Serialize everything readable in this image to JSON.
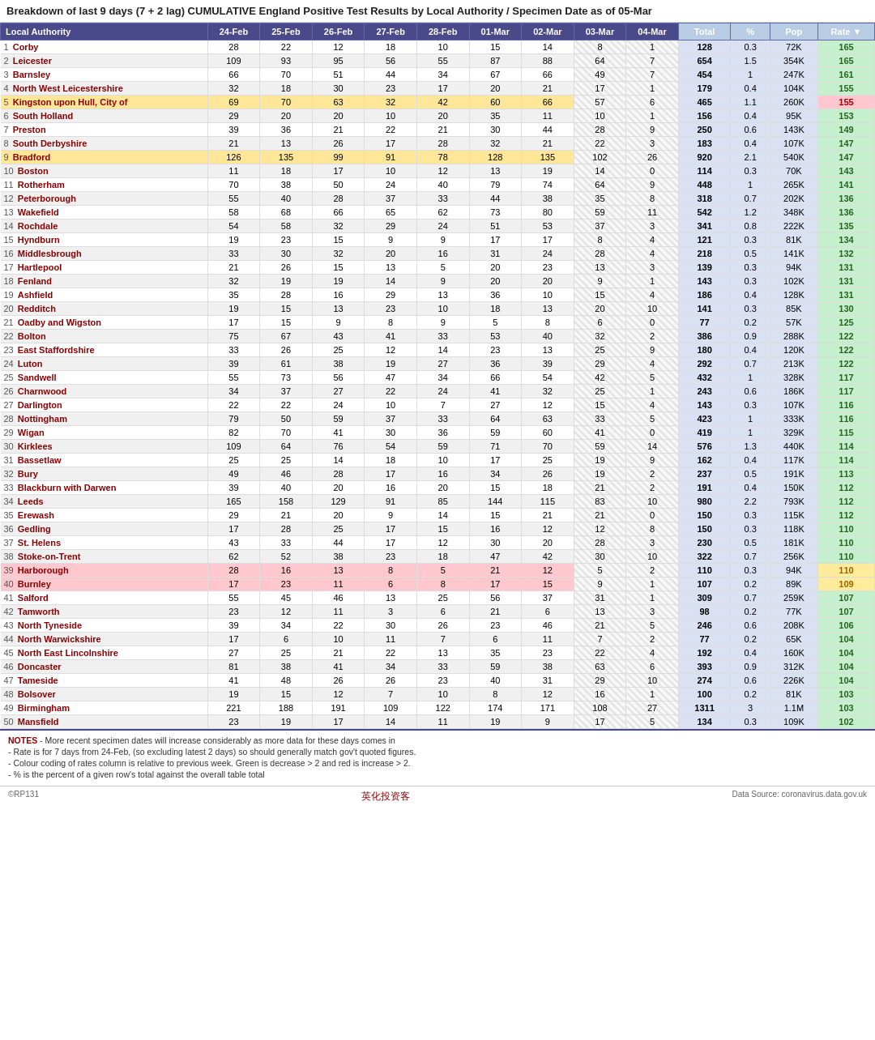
{
  "title": "Breakdown of last 9 days (7 + 2 lag)  CUMULATIVE England Positive Test Results by Local Authority / Specimen Date as of 05-Mar",
  "columns": [
    "Local Authority",
    "24-Feb",
    "25-Feb",
    "26-Feb",
    "27-Feb",
    "28-Feb",
    "01-Mar",
    "02-Mar",
    "03-Mar",
    "04-Mar",
    "Total",
    "%",
    "Pop",
    "Rate ▼"
  ],
  "rows": [
    {
      "rank": 1,
      "name": "Corby",
      "d1": 28,
      "d2": 22,
      "d3": 12,
      "d4": 18,
      "d5": 10,
      "d6": 15,
      "d7": 14,
      "d8": 8,
      "d9": 1,
      "total": 128,
      "pct": 0.3,
      "pop": "72K",
      "rate": 165,
      "rate_class": "rate-green"
    },
    {
      "rank": 2,
      "name": "Leicester",
      "d1": 109,
      "d2": 93,
      "d3": 95,
      "d4": 56,
      "d5": 55,
      "d6": 87,
      "d7": 88,
      "d8": 64,
      "d9": 7,
      "total": 654,
      "pct": 1.5,
      "pop": "354K",
      "rate": 165,
      "rate_class": "rate-green"
    },
    {
      "rank": 3,
      "name": "Barnsley",
      "d1": 66,
      "d2": 70,
      "d3": 51,
      "d4": 44,
      "d5": 34,
      "d6": 67,
      "d7": 66,
      "d8": 49,
      "d9": 7,
      "total": 454,
      "pct": 1.0,
      "pop": "247K",
      "rate": 161,
      "rate_class": "rate-green"
    },
    {
      "rank": 4,
      "name": "North West Leicestershire",
      "d1": 32,
      "d2": 18,
      "d3": 30,
      "d4": 23,
      "d5": 17,
      "d6": 20,
      "d7": 21,
      "d8": 17,
      "d9": 1,
      "total": 179,
      "pct": 0.4,
      "pop": "104K",
      "rate": 155,
      "rate_class": "rate-green"
    },
    {
      "rank": 5,
      "name": "Kingston upon Hull, City of",
      "d1": 69,
      "d2": 70,
      "d3": 63,
      "d4": 32,
      "d5": 42,
      "d6": 60,
      "d7": 66,
      "d8": 57,
      "d9": 6,
      "total": 465,
      "pct": 1.1,
      "pop": "260K",
      "rate": 155,
      "rate_class": "rate-red",
      "highlight": true
    },
    {
      "rank": 6,
      "name": "South Holland",
      "d1": 29,
      "d2": 20,
      "d3": 20,
      "d4": 10,
      "d5": 20,
      "d6": 35,
      "d7": 11,
      "d8": 10,
      "d9": 1,
      "total": 156,
      "pct": 0.4,
      "pop": "95K",
      "rate": 153,
      "rate_class": "rate-green"
    },
    {
      "rank": 7,
      "name": "Preston",
      "d1": 39,
      "d2": 36,
      "d3": 21,
      "d4": 22,
      "d5": 21,
      "d6": 30,
      "d7": 44,
      "d8": 28,
      "d9": 9,
      "total": 250,
      "pct": 0.6,
      "pop": "143K",
      "rate": 149,
      "rate_class": "rate-green"
    },
    {
      "rank": 8,
      "name": "South Derbyshire",
      "d1": 21,
      "d2": 13,
      "d3": 26,
      "d4": 17,
      "d5": 28,
      "d6": 32,
      "d7": 21,
      "d8": 22,
      "d9": 3,
      "total": 183,
      "pct": 0.4,
      "pop": "107K",
      "rate": 147,
      "rate_class": "rate-green"
    },
    {
      "rank": 9,
      "name": "Bradford",
      "d1": 126,
      "d2": 135,
      "d3": 99,
      "d4": 91,
      "d5": 78,
      "d6": 128,
      "d7": 135,
      "d8": 102,
      "d9": 26,
      "total": 920,
      "pct": 2.1,
      "pop": "540K",
      "rate": 147,
      "rate_class": "rate-green",
      "highlight": true
    },
    {
      "rank": 10,
      "name": "Boston",
      "d1": 11,
      "d2": 18,
      "d3": 17,
      "d4": 10,
      "d5": 12,
      "d6": 13,
      "d7": 19,
      "d8": 14,
      "d9": 0,
      "total": 114,
      "pct": 0.3,
      "pop": "70K",
      "rate": 143,
      "rate_class": "rate-green"
    },
    {
      "rank": 11,
      "name": "Rotherham",
      "d1": 70,
      "d2": 38,
      "d3": 50,
      "d4": 24,
      "d5": 40,
      "d6": 79,
      "d7": 74,
      "d8": 64,
      "d9": 9,
      "total": 448,
      "pct": 1.0,
      "pop": "265K",
      "rate": 141,
      "rate_class": "rate-green"
    },
    {
      "rank": 12,
      "name": "Peterborough",
      "d1": 55,
      "d2": 40,
      "d3": 28,
      "d4": 37,
      "d5": 33,
      "d6": 44,
      "d7": 38,
      "d8": 35,
      "d9": 8,
      "total": 318,
      "pct": 0.7,
      "pop": "202K",
      "rate": 136,
      "rate_class": "rate-green"
    },
    {
      "rank": 13,
      "name": "Wakefield",
      "d1": 58,
      "d2": 68,
      "d3": 66,
      "d4": 65,
      "d5": 62,
      "d6": 73,
      "d7": 80,
      "d8": 59,
      "d9": 11,
      "total": 542,
      "pct": 1.2,
      "pop": "348K",
      "rate": 136,
      "rate_class": "rate-green"
    },
    {
      "rank": 14,
      "name": "Rochdale",
      "d1": 54,
      "d2": 58,
      "d3": 32,
      "d4": 29,
      "d5": 24,
      "d6": 51,
      "d7": 53,
      "d8": 37,
      "d9": 3,
      "total": 341,
      "pct": 0.8,
      "pop": "222K",
      "rate": 135,
      "rate_class": "rate-green"
    },
    {
      "rank": 15,
      "name": "Hyndburn",
      "d1": 19,
      "d2": 23,
      "d3": 15,
      "d4": 9,
      "d5": 9,
      "d6": 17,
      "d7": 17,
      "d8": 8,
      "d9": 4,
      "total": 121,
      "pct": 0.3,
      "pop": "81K",
      "rate": 134,
      "rate_class": "rate-green"
    },
    {
      "rank": 16,
      "name": "Middlesbrough",
      "d1": 33,
      "d2": 30,
      "d3": 32,
      "d4": 20,
      "d5": 16,
      "d6": 31,
      "d7": 24,
      "d8": 28,
      "d9": 4,
      "total": 218,
      "pct": 0.5,
      "pop": "141K",
      "rate": 132,
      "rate_class": "rate-green"
    },
    {
      "rank": 17,
      "name": "Hartlepool",
      "d1": 21,
      "d2": 26,
      "d3": 15,
      "d4": 13,
      "d5": 5,
      "d6": 20,
      "d7": 23,
      "d8": 13,
      "d9": 3,
      "total": 139,
      "pct": 0.3,
      "pop": "94K",
      "rate": 131,
      "rate_class": "rate-green"
    },
    {
      "rank": 18,
      "name": "Fenland",
      "d1": 32,
      "d2": 19,
      "d3": 19,
      "d4": 14,
      "d5": 9,
      "d6": 20,
      "d7": 20,
      "d8": 9,
      "d9": 1,
      "total": 143,
      "pct": 0.3,
      "pop": "102K",
      "rate": 131,
      "rate_class": "rate-green"
    },
    {
      "rank": 19,
      "name": "Ashfield",
      "d1": 35,
      "d2": 28,
      "d3": 16,
      "d4": 29,
      "d5": 13,
      "d6": 36,
      "d7": 10,
      "d8": 15,
      "d9": 4,
      "total": 186,
      "pct": 0.4,
      "pop": "128K",
      "rate": 131,
      "rate_class": "rate-green"
    },
    {
      "rank": 20,
      "name": "Redditch",
      "d1": 19,
      "d2": 15,
      "d3": 13,
      "d4": 23,
      "d5": 10,
      "d6": 18,
      "d7": 13,
      "d8": 20,
      "d9": 10,
      "total": 141,
      "pct": 0.3,
      "pop": "85K",
      "rate": 130,
      "rate_class": "rate-green"
    },
    {
      "rank": 21,
      "name": "Oadby and Wigston",
      "d1": 17,
      "d2": 15,
      "d3": 9,
      "d4": 8,
      "d5": 9,
      "d6": 5,
      "d7": 8,
      "d8": 6,
      "d9": 0,
      "total": 77,
      "pct": 0.2,
      "pop": "57K",
      "rate": 125,
      "rate_class": "rate-green"
    },
    {
      "rank": 22,
      "name": "Bolton",
      "d1": 75,
      "d2": 67,
      "d3": 43,
      "d4": 41,
      "d5": 33,
      "d6": 53,
      "d7": 40,
      "d8": 32,
      "d9": 2,
      "total": 386,
      "pct": 0.9,
      "pop": "288K",
      "rate": 122,
      "rate_class": "rate-green"
    },
    {
      "rank": 23,
      "name": "East Staffordshire",
      "d1": 33,
      "d2": 26,
      "d3": 25,
      "d4": 12,
      "d5": 14,
      "d6": 23,
      "d7": 13,
      "d8": 25,
      "d9": 9,
      "total": 180,
      "pct": 0.4,
      "pop": "120K",
      "rate": 122,
      "rate_class": "rate-green"
    },
    {
      "rank": 24,
      "name": "Luton",
      "d1": 39,
      "d2": 61,
      "d3": 38,
      "d4": 19,
      "d5": 27,
      "d6": 36,
      "d7": 39,
      "d8": 29,
      "d9": 4,
      "total": 292,
      "pct": 0.7,
      "pop": "213K",
      "rate": 122,
      "rate_class": "rate-green"
    },
    {
      "rank": 25,
      "name": "Sandwell",
      "d1": 55,
      "d2": 73,
      "d3": 56,
      "d4": 47,
      "d5": 34,
      "d6": 66,
      "d7": 54,
      "d8": 42,
      "d9": 5,
      "total": 432,
      "pct": 1.0,
      "pop": "328K",
      "rate": 117,
      "rate_class": "rate-green"
    },
    {
      "rank": 26,
      "name": "Charnwood",
      "d1": 34,
      "d2": 37,
      "d3": 27,
      "d4": 22,
      "d5": 24,
      "d6": 41,
      "d7": 32,
      "d8": 25,
      "d9": 1,
      "total": 243,
      "pct": 0.6,
      "pop": "186K",
      "rate": 117,
      "rate_class": "rate-green"
    },
    {
      "rank": 27,
      "name": "Darlington",
      "d1": 22,
      "d2": 22,
      "d3": 24,
      "d4": 10,
      "d5": 7,
      "d6": 27,
      "d7": 12,
      "d8": 15,
      "d9": 4,
      "total": 143,
      "pct": 0.3,
      "pop": "107K",
      "rate": 116,
      "rate_class": "rate-green"
    },
    {
      "rank": 28,
      "name": "Nottingham",
      "d1": 79,
      "d2": 50,
      "d3": 59,
      "d4": 37,
      "d5": 33,
      "d6": 64,
      "d7": 63,
      "d8": 33,
      "d9": 5,
      "total": 423,
      "pct": 1.0,
      "pop": "333K",
      "rate": 116,
      "rate_class": "rate-green"
    },
    {
      "rank": 29,
      "name": "Wigan",
      "d1": 82,
      "d2": 70,
      "d3": 41,
      "d4": 30,
      "d5": 36,
      "d6": 59,
      "d7": 60,
      "d8": 41,
      "d9": 0,
      "total": 419,
      "pct": 1.0,
      "pop": "329K",
      "rate": 115,
      "rate_class": "rate-green"
    },
    {
      "rank": 30,
      "name": "Kirklees",
      "d1": 109,
      "d2": 64,
      "d3": 76,
      "d4": 54,
      "d5": 59,
      "d6": 71,
      "d7": 70,
      "d8": 59,
      "d9": 14,
      "total": 576,
      "pct": 1.3,
      "pop": "440K",
      "rate": 114,
      "rate_class": "rate-green"
    },
    {
      "rank": 31,
      "name": "Bassetlaw",
      "d1": 25,
      "d2": 25,
      "d3": 14,
      "d4": 18,
      "d5": 10,
      "d6": 17,
      "d7": 25,
      "d8": 19,
      "d9": 9,
      "total": 162,
      "pct": 0.4,
      "pop": "117K",
      "rate": 114,
      "rate_class": "rate-green"
    },
    {
      "rank": 32,
      "name": "Bury",
      "d1": 49,
      "d2": 46,
      "d3": 28,
      "d4": 17,
      "d5": 16,
      "d6": 34,
      "d7": 26,
      "d8": 19,
      "d9": 2,
      "total": 237,
      "pct": 0.5,
      "pop": "191K",
      "rate": 113,
      "rate_class": "rate-green"
    },
    {
      "rank": 33,
      "name": "Blackburn with Darwen",
      "d1": 39,
      "d2": 40,
      "d3": 20,
      "d4": 16,
      "d5": 20,
      "d6": 15,
      "d7": 18,
      "d8": 21,
      "d9": 2,
      "total": 191,
      "pct": 0.4,
      "pop": "150K",
      "rate": 112,
      "rate_class": "rate-green"
    },
    {
      "rank": 34,
      "name": "Leeds",
      "d1": 165,
      "d2": 158,
      "d3": 129,
      "d4": 91,
      "d5": 85,
      "d6": 144,
      "d7": 115,
      "d8": 83,
      "d9": 10,
      "total": 980,
      "pct": 2.2,
      "pop": "793K",
      "rate": 112,
      "rate_class": "rate-green"
    },
    {
      "rank": 35,
      "name": "Erewash",
      "d1": 29,
      "d2": 21,
      "d3": 20,
      "d4": 9,
      "d5": 14,
      "d6": 15,
      "d7": 21,
      "d8": 21,
      "d9": 0,
      "total": 150,
      "pct": 0.3,
      "pop": "115K",
      "rate": 112,
      "rate_class": "rate-green"
    },
    {
      "rank": 36,
      "name": "Gedling",
      "d1": 17,
      "d2": 28,
      "d3": 25,
      "d4": 17,
      "d5": 15,
      "d6": 16,
      "d7": 12,
      "d8": 12,
      "d9": 8,
      "total": 150,
      "pct": 0.3,
      "pop": "118K",
      "rate": 110,
      "rate_class": "rate-green"
    },
    {
      "rank": 37,
      "name": "St. Helens",
      "d1": 43,
      "d2": 33,
      "d3": 44,
      "d4": 17,
      "d5": 12,
      "d6": 30,
      "d7": 20,
      "d8": 28,
      "d9": 3,
      "total": 230,
      "pct": 0.5,
      "pop": "181K",
      "rate": 110,
      "rate_class": "rate-green"
    },
    {
      "rank": 38,
      "name": "Stoke-on-Trent",
      "d1": 62,
      "d2": 52,
      "d3": 38,
      "d4": 23,
      "d5": 18,
      "d6": 47,
      "d7": 42,
      "d8": 30,
      "d9": 10,
      "total": 322,
      "pct": 0.7,
      "pop": "256K",
      "rate": 110,
      "rate_class": "rate-green"
    },
    {
      "rank": 39,
      "name": "Harborough",
      "d1": 28,
      "d2": 16,
      "d3": 13,
      "d4": 8,
      "d5": 5,
      "d6": 21,
      "d7": 12,
      "d8": 5,
      "d9": 2,
      "total": 110,
      "pct": 0.3,
      "pop": "94K",
      "rate": 110,
      "rate_class": "rate-yellow",
      "highlight_pink": true
    },
    {
      "rank": 40,
      "name": "Burnley",
      "d1": 17,
      "d2": 23,
      "d3": 11,
      "d4": 6,
      "d5": 8,
      "d6": 17,
      "d7": 15,
      "d8": 9,
      "d9": 1,
      "total": 107,
      "pct": 0.2,
      "pop": "89K",
      "rate": 109,
      "rate_class": "rate-yellow",
      "highlight_pink": true
    },
    {
      "rank": 41,
      "name": "Salford",
      "d1": 55,
      "d2": 45,
      "d3": 46,
      "d4": 13,
      "d5": 25,
      "d6": 56,
      "d7": 37,
      "d8": 31,
      "d9": 1,
      "total": 309,
      "pct": 0.7,
      "pop": "259K",
      "rate": 107,
      "rate_class": "rate-green"
    },
    {
      "rank": 42,
      "name": "Tamworth",
      "d1": 23,
      "d2": 12,
      "d3": 11,
      "d4": 3,
      "d5": 6,
      "d6": 21,
      "d7": 6,
      "d8": 13,
      "d9": 3,
      "total": 98,
      "pct": 0.2,
      "pop": "77K",
      "rate": 107,
      "rate_class": "rate-green"
    },
    {
      "rank": 43,
      "name": "North Tyneside",
      "d1": 39,
      "d2": 34,
      "d3": 22,
      "d4": 30,
      "d5": 26,
      "d6": 23,
      "d7": 46,
      "d8": 21,
      "d9": 5,
      "total": 246,
      "pct": 0.6,
      "pop": "208K",
      "rate": 106,
      "rate_class": "rate-green"
    },
    {
      "rank": 44,
      "name": "North Warwickshire",
      "d1": 17,
      "d2": 6,
      "d3": 10,
      "d4": 11,
      "d5": 7,
      "d6": 6,
      "d7": 11,
      "d8": 7,
      "d9": 2,
      "total": 77,
      "pct": 0.2,
      "pop": "65K",
      "rate": 104,
      "rate_class": "rate-green"
    },
    {
      "rank": 45,
      "name": "North East Lincolnshire",
      "d1": 27,
      "d2": 25,
      "d3": 21,
      "d4": 22,
      "d5": 13,
      "d6": 35,
      "d7": 23,
      "d8": 22,
      "d9": 4,
      "total": 192,
      "pct": 0.4,
      "pop": "160K",
      "rate": 104,
      "rate_class": "rate-green"
    },
    {
      "rank": 46,
      "name": "Doncaster",
      "d1": 81,
      "d2": 38,
      "d3": 41,
      "d4": 34,
      "d5": 33,
      "d6": 59,
      "d7": 38,
      "d8": 63,
      "d9": 6,
      "total": 393,
      "pct": 0.9,
      "pop": "312K",
      "rate": 104,
      "rate_class": "rate-green"
    },
    {
      "rank": 47,
      "name": "Tameside",
      "d1": 41,
      "d2": 48,
      "d3": 26,
      "d4": 26,
      "d5": 23,
      "d6": 40,
      "d7": 31,
      "d8": 29,
      "d9": 10,
      "total": 274,
      "pct": 0.6,
      "pop": "226K",
      "rate": 104,
      "rate_class": "rate-green"
    },
    {
      "rank": 48,
      "name": "Bolsover",
      "d1": 19,
      "d2": 15,
      "d3": 12,
      "d4": 7,
      "d5": 10,
      "d6": 8,
      "d7": 12,
      "d8": 16,
      "d9": 1,
      "total": 100,
      "pct": 0.2,
      "pop": "81K",
      "rate": 103,
      "rate_class": "rate-green"
    },
    {
      "rank": 49,
      "name": "Birmingham",
      "d1": 221,
      "d2": 188,
      "d3": 191,
      "d4": 109,
      "d5": 122,
      "d6": 174,
      "d7": 171,
      "d8": 108,
      "d9": 27,
      "total": 1311,
      "pct": 3.0,
      "pop": "1.1M",
      "rate": 103,
      "rate_class": "rate-green"
    },
    {
      "rank": 50,
      "name": "Mansfield",
      "d1": 23,
      "d2": 19,
      "d3": 17,
      "d4": 14,
      "d5": 11,
      "d6": 19,
      "d7": 9,
      "d8": 17,
      "d9": 5,
      "total": 134,
      "pct": 0.3,
      "pop": "109K",
      "rate": 102,
      "rate_class": "rate-green"
    }
  ],
  "notes": [
    "NOTES   - More recent specimen dates will increase considerably as more data for these days comes in",
    "- Rate is for 7 days from 24-Feb, (so excluding latest 2 days) so should generally match gov't quoted figures.",
    "- Colour coding of rates column is relative to previous week. Green is decrease > 2 and red is increase > 2.",
    "- % is the percent of a given row's total against the overall table total"
  ],
  "footer_left": "©RP131",
  "footer_right": "Data Source: coronavirus.data.gov.uk",
  "watermark": "英化投资客"
}
